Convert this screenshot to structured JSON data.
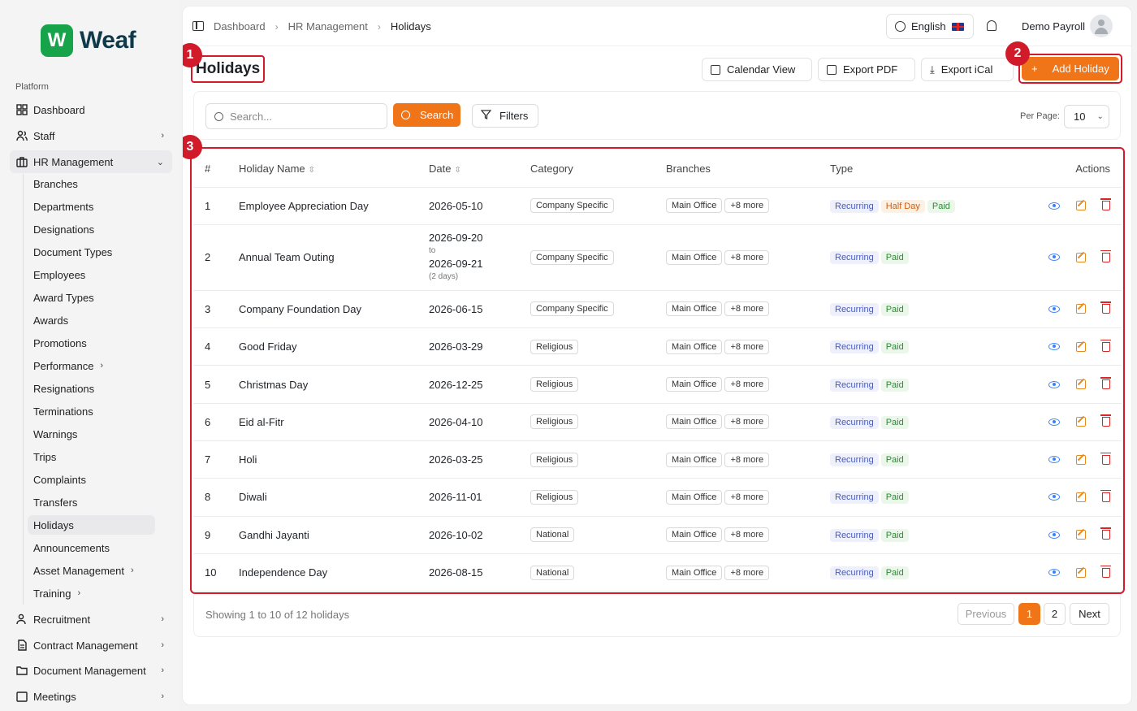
{
  "brand": {
    "logo_letter": "W",
    "name": "Weaf"
  },
  "sidebar": {
    "section": "Platform",
    "items": [
      {
        "label": "Dashboard",
        "icon": "grid-icon"
      },
      {
        "label": "Staff",
        "icon": "users-icon"
      },
      {
        "label": "HR Management",
        "icon": "briefcase-icon"
      }
    ],
    "hr_sub": [
      "Branches",
      "Departments",
      "Designations",
      "Document Types",
      "Employees",
      "Award Types",
      "Awards",
      "Promotions",
      "Performance",
      "Resignations",
      "Terminations",
      "Warnings",
      "Trips",
      "Complaints",
      "Transfers",
      "Holidays",
      "Announcements",
      "Asset Management",
      "Training"
    ],
    "bottom_items": [
      {
        "label": "Recruitment",
        "icon": "user-search-icon"
      },
      {
        "label": "Contract Management",
        "icon": "file-icon"
      },
      {
        "label": "Document Management",
        "icon": "folder-icon"
      },
      {
        "label": "Meetings",
        "icon": "calendar-icon"
      }
    ]
  },
  "topbar": {
    "breadcrumb": [
      "Dashboard",
      "HR Management",
      "Holidays"
    ],
    "language": "English",
    "user": "Demo Payroll"
  },
  "page": {
    "title": "Holidays",
    "calendar_view": "Calendar View",
    "export_pdf": "Export PDF",
    "export_ical": "Export iCal",
    "add": "Add Holiday",
    "markers": [
      "1",
      "2",
      "3"
    ]
  },
  "filters": {
    "search_placeholder": "Search...",
    "search_button": "Search",
    "filters_button": "Filters",
    "per_page_label": "Per Page:",
    "per_page": "10"
  },
  "table": {
    "headers": [
      "#",
      "Holiday Name",
      "Date",
      "Category",
      "Branches",
      "Type",
      "Actions"
    ],
    "rows": [
      {
        "num": "1",
        "name": "Employee Appreciation Day",
        "date": "2026-05-10",
        "category": "Company Specific",
        "branch": "Main Office",
        "more": "+8 more",
        "recurring": "Recurring",
        "half": "Half Day",
        "paid": "Paid"
      },
      {
        "num": "2",
        "name": "Annual Team Outing",
        "date": "2026-09-20",
        "to": "to",
        "date_end": "2026-09-21",
        "duration": "(2 days)",
        "category": "Company Specific",
        "branch": "Main Office",
        "more": "+8 more",
        "recurring": "Recurring",
        "paid": "Paid"
      },
      {
        "num": "3",
        "name": "Company Foundation Day",
        "date": "2026-06-15",
        "category": "Company Specific",
        "branch": "Main Office",
        "more": "+8 more",
        "recurring": "Recurring",
        "paid": "Paid"
      },
      {
        "num": "4",
        "name": "Good Friday",
        "date": "2026-03-29",
        "category": "Religious",
        "branch": "Main Office",
        "more": "+8 more",
        "recurring": "Recurring",
        "paid": "Paid"
      },
      {
        "num": "5",
        "name": "Christmas Day",
        "date": "2026-12-25",
        "category": "Religious",
        "branch": "Main Office",
        "more": "+8 more",
        "recurring": "Recurring",
        "paid": "Paid"
      },
      {
        "num": "6",
        "name": "Eid al-Fitr",
        "date": "2026-04-10",
        "category": "Religious",
        "branch": "Main Office",
        "more": "+8 more",
        "recurring": "Recurring",
        "paid": "Paid"
      },
      {
        "num": "7",
        "name": "Holi",
        "date": "2026-03-25",
        "category": "Religious",
        "branch": "Main Office",
        "more": "+8 more",
        "recurring": "Recurring",
        "paid": "Paid"
      },
      {
        "num": "8",
        "name": "Diwali",
        "date": "2026-11-01",
        "category": "Religious",
        "branch": "Main Office",
        "more": "+8 more",
        "recurring": "Recurring",
        "paid": "Paid"
      },
      {
        "num": "9",
        "name": "Gandhi Jayanti",
        "date": "2026-10-02",
        "category": "National",
        "branch": "Main Office",
        "more": "+8 more",
        "recurring": "Recurring",
        "paid": "Paid"
      },
      {
        "num": "10",
        "name": "Independence Day",
        "date": "2026-08-15",
        "category": "National",
        "branch": "Main Office",
        "more": "+8 more",
        "recurring": "Recurring",
        "paid": "Paid"
      }
    ]
  },
  "pagination": {
    "summary": "Showing 1 to 10 of 12 holidays",
    "previous": "Previous",
    "pages": [
      "1",
      "2"
    ],
    "next": "Next"
  },
  "colors": {
    "accent": "#f07418",
    "annotation": "#d11a2a",
    "brand_green": "#16a34a"
  }
}
